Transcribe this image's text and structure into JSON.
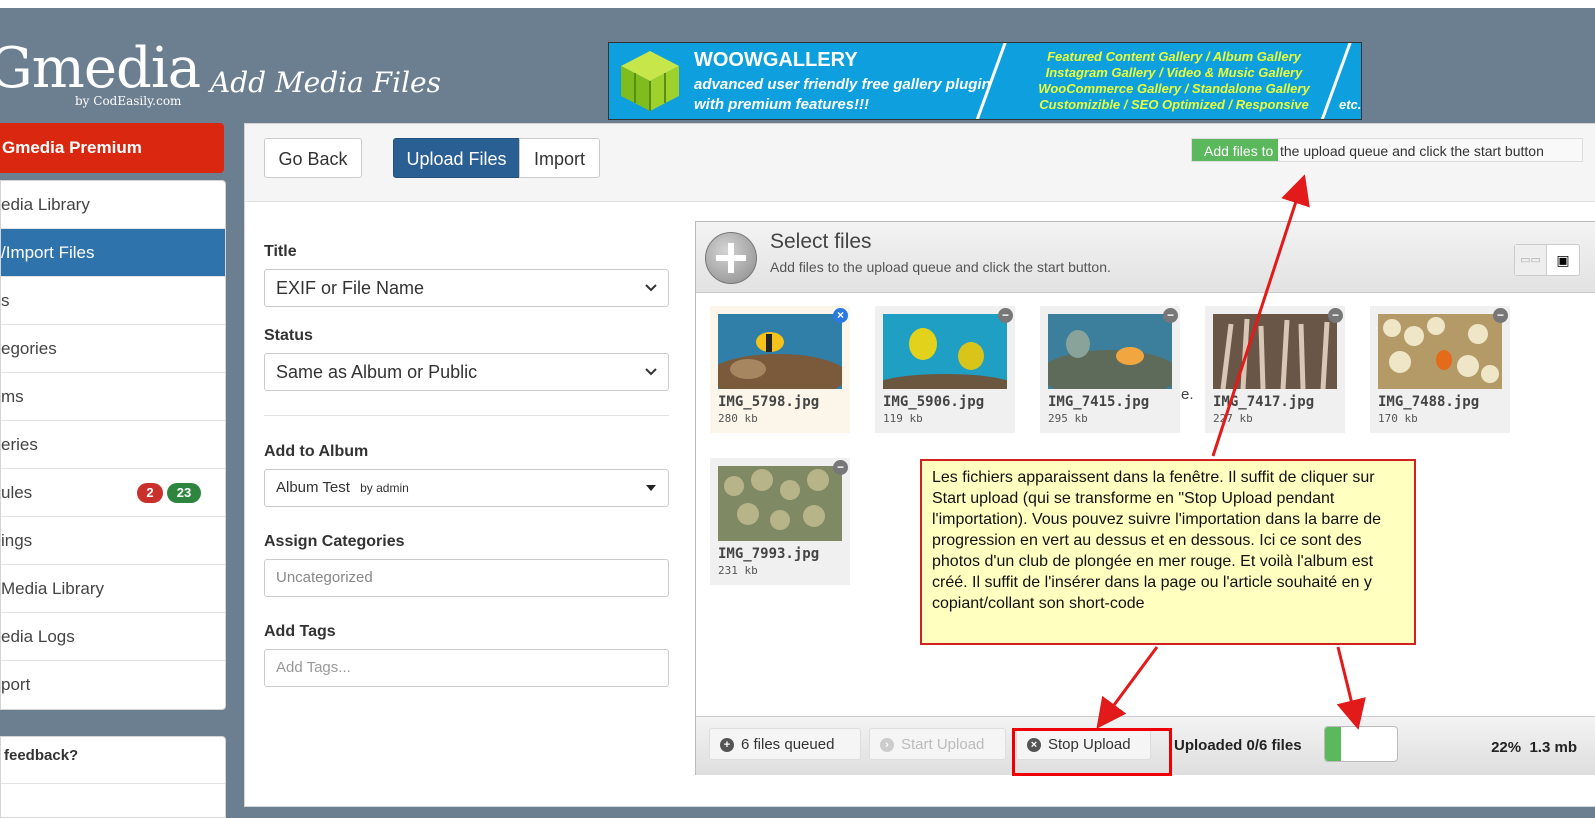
{
  "header": {
    "logo_text": "Gmedia",
    "logo_by": "by CodEasily.com",
    "page_title": "Add Media Files"
  },
  "banner": {
    "title": "WOOWGALLERY",
    "subtitle": "advanced user friendly free gallery plugin with premium features!!!",
    "features_line1": "Featured Content Gallery  /  Album Gallery",
    "features_line2": "Instagram Gallery  /  Video & Music Gallery",
    "features_line3": "WooCommerce Gallery  /  Standalone Gallery",
    "features_line4": "Customizible  /  SEO Optimized  /  Responsive",
    "etc": "etc."
  },
  "sidebar": {
    "premium": "Gmedia Premium",
    "items": [
      {
        "label": "edia Library"
      },
      {
        "label": "/Import Files"
      },
      {
        "label": "s"
      },
      {
        "label": "egories"
      },
      {
        "label": "ms"
      },
      {
        "label": "eries"
      },
      {
        "label": "ules",
        "badge_red": "2",
        "badge_green": "23"
      },
      {
        "label": "ings"
      },
      {
        "label": "Media Library"
      },
      {
        "label": "edia Logs"
      },
      {
        "label": "port"
      }
    ],
    "feedback": "feedback?"
  },
  "toolbar": {
    "go_back": "Go Back",
    "upload_files": "Upload Files",
    "import": "Import",
    "hint_part1": "Add files to",
    "hint_part2": "the upload queue and click the start button"
  },
  "form": {
    "title_label": "Title",
    "title_value": "EXIF or File Name",
    "status_label": "Status",
    "status_value": "Same as Album or Public",
    "album_label": "Add to Album",
    "album_value": "Album Test",
    "album_by": "by admin",
    "categories_label": "Assign Categories",
    "categories_value": "Uncategorized",
    "tags_label": "Add Tags",
    "tags_placeholder": "Add Tags..."
  },
  "uploader": {
    "title": "Select files",
    "subtitle": "Add files to the upload queue and click the start button.",
    "stray_text": "e.",
    "files": [
      {
        "name": "IMG_5798.jpg",
        "size": "280 kb"
      },
      {
        "name": "IMG_5906.jpg",
        "size": "119 kb"
      },
      {
        "name": "IMG_7415.jpg",
        "size": "295 kb"
      },
      {
        "name": "IMG_7417.jpg",
        "size": "227 kb"
      },
      {
        "name": "IMG_7488.jpg",
        "size": "170 kb"
      },
      {
        "name": "IMG_7993.jpg",
        "size": "231 kb"
      }
    ],
    "queued": "6 files queued",
    "start_upload": "Start Upload",
    "stop_upload": "Stop Upload",
    "uploaded_status": "Uploaded 0/6 files",
    "percent": "22%",
    "size_total": "1.3 mb",
    "progress_fraction": 0.22
  },
  "annotation": {
    "text": "Les fichiers apparaissent dans la fenêtre. Il suffit de cliquer sur Start upload (qui se transforme en \"Stop Upload pendant l'importation). Vous pouvez suivre l'importation dans la barre de progression en vert au dessus et en dessous. Ici ce sont des photos d'un club de plongée en mer rouge. Et voilà l'album est créé. Il suffit de l'insérer dans la page ou l'article souhaité en y copiant/collant son short-code"
  },
  "colors": {
    "header_bg": "#6c7f91",
    "premium_red": "#d9280f",
    "active_blue": "#2f73ad",
    "progress_green": "#5cb85c",
    "annotation_bg": "#ffffc0",
    "annotation_red": "#d32020"
  }
}
